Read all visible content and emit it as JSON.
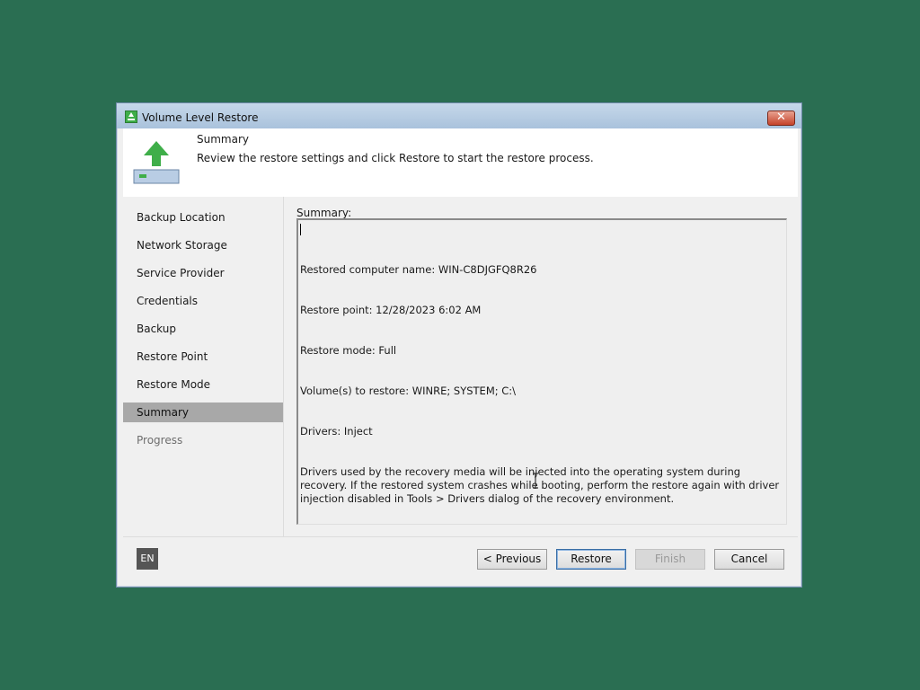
{
  "window": {
    "title": "Volume Level Restore",
    "close_glyph": "✕"
  },
  "header": {
    "title": "Summary",
    "description": "Review the restore settings and click Restore to start the restore process.",
    "icon": "restore-upload-icon",
    "accent_color": "#3fae49"
  },
  "sidebar": {
    "items": [
      {
        "label": "Backup Location",
        "state": "normal"
      },
      {
        "label": "Network Storage",
        "state": "normal"
      },
      {
        "label": "Service Provider",
        "state": "normal"
      },
      {
        "label": "Credentials",
        "state": "normal"
      },
      {
        "label": "Backup",
        "state": "normal"
      },
      {
        "label": "Restore Point",
        "state": "normal"
      },
      {
        "label": "Restore Mode",
        "state": "normal"
      },
      {
        "label": "Summary",
        "state": "active"
      },
      {
        "label": "Progress",
        "state": "disabled"
      }
    ]
  },
  "content": {
    "label": "Summary:",
    "lines": [
      "Restored computer name: WIN-C8DJGFQ8R26",
      "Restore point: 12/28/2023 6:02 AM",
      "Restore mode: Full",
      "Volume(s) to restore: WINRE; SYSTEM; C:\\",
      "Drivers: Inject",
      "Drivers used by the recovery media will be injected into the operating system during recovery. If the restored system crashes while booting, perform the restore again with driver injection disabled in Tools > Drivers dialog of the recovery environment."
    ]
  },
  "footer": {
    "language": "EN",
    "previous_label": "< Previous",
    "restore_label": "Restore",
    "finish_label": "Finish",
    "cancel_label": "Cancel"
  }
}
